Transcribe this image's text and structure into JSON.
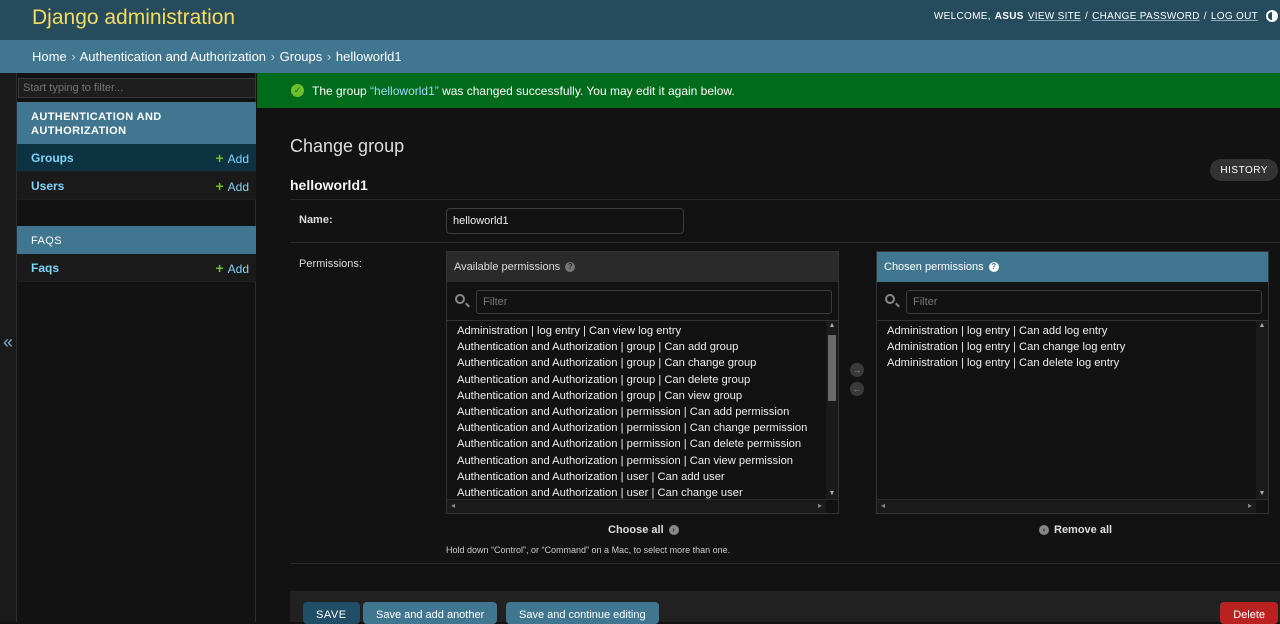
{
  "header": {
    "branding": "Django administration",
    "welcome": "WELCOME,",
    "username": "ASUS",
    "view_site": "VIEW SITE",
    "change_password": "CHANGE PASSWORD",
    "log_out": "LOG OUT",
    "sep": "/",
    "sep2": "/"
  },
  "breadcrumbs": {
    "home": "Home",
    "app": "Authentication and Authorization",
    "model": "Groups",
    "current": "helloworld1",
    "sep": "›"
  },
  "sidebar": {
    "filter_placeholder": "Start typing to filter...",
    "modules": [
      {
        "caption": "AUTHENTICATION AND AUTHORIZATION",
        "items": [
          {
            "label": "Groups",
            "add": "Add"
          },
          {
            "label": "Users",
            "add": "Add"
          }
        ]
      },
      {
        "caption": "FAQS",
        "items": [
          {
            "label": "Faqs",
            "add": "Add"
          }
        ]
      }
    ],
    "collapse_icon": "«"
  },
  "message": {
    "prefix": "The group ",
    "link": "“helloworld1”",
    "suffix": " was changed successfully. You may edit it again below."
  },
  "page": {
    "title": "Change group",
    "object_title": "helloworld1",
    "history": "HISTORY"
  },
  "form": {
    "name_label": "Name:",
    "name_value": "helloworld1",
    "permissions_label": "Permissions:",
    "available_title": "Available permissions",
    "chosen_title": "Chosen permissions",
    "filter_placeholder": "Filter",
    "available": [
      "Administration | log entry | Can view log entry",
      "Authentication and Authorization | group | Can add group",
      "Authentication and Authorization | group | Can change group",
      "Authentication and Authorization | group | Can delete group",
      "Authentication and Authorization | group | Can view group",
      "Authentication and Authorization | permission | Can add permission",
      "Authentication and Authorization | permission | Can change permission",
      "Authentication and Authorization | permission | Can delete permission",
      "Authentication and Authorization | permission | Can view permission",
      "Authentication and Authorization | user | Can add user",
      "Authentication and Authorization | user | Can change user"
    ],
    "chosen": [
      "Administration | log entry | Can add log entry",
      "Administration | log entry | Can change log entry",
      "Administration | log entry | Can delete log entry"
    ],
    "choose_all": "Choose all",
    "remove_all": "Remove all",
    "help_text": "Hold down “Control”, or “Command” on a Mac, to select more than one."
  },
  "submit": {
    "save": "SAVE",
    "save_add": "Save and add another",
    "save_continue": "Save and continue editing",
    "delete": "Delete"
  },
  "colors": {
    "header_bg": "#264b5d",
    "branding": "#f5dd5d",
    "breadcrumbs_bg": "#417690",
    "success_bg": "#006b1b",
    "delete_bg": "#ba2121"
  }
}
